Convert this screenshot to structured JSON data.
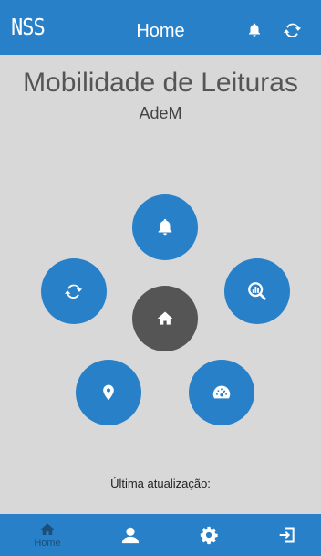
{
  "header": {
    "logo": "NSS",
    "title": "Home",
    "bell_icon": "bell-icon",
    "sync_icon": "sync-icon"
  },
  "main": {
    "title": "Mobilidade de Leituras",
    "subtitle": "AdeM",
    "last_update_label": "Última atualização:",
    "menu": [
      {
        "name": "notifications",
        "icon": "bell-icon"
      },
      {
        "name": "sync",
        "icon": "sync-icon"
      },
      {
        "name": "analytics",
        "icon": "magnifier-chart-icon"
      },
      {
        "name": "home",
        "icon": "home-icon"
      },
      {
        "name": "location",
        "icon": "map-pin-icon"
      },
      {
        "name": "meter",
        "icon": "speedometer-icon"
      }
    ]
  },
  "bottom_nav": {
    "home_label": "Home",
    "items": [
      "home-icon",
      "user-icon",
      "gear-icon",
      "logout-icon"
    ]
  },
  "colors": {
    "primary": "#2880c8",
    "home_button": "#555556",
    "background": "#d8d8d8"
  }
}
